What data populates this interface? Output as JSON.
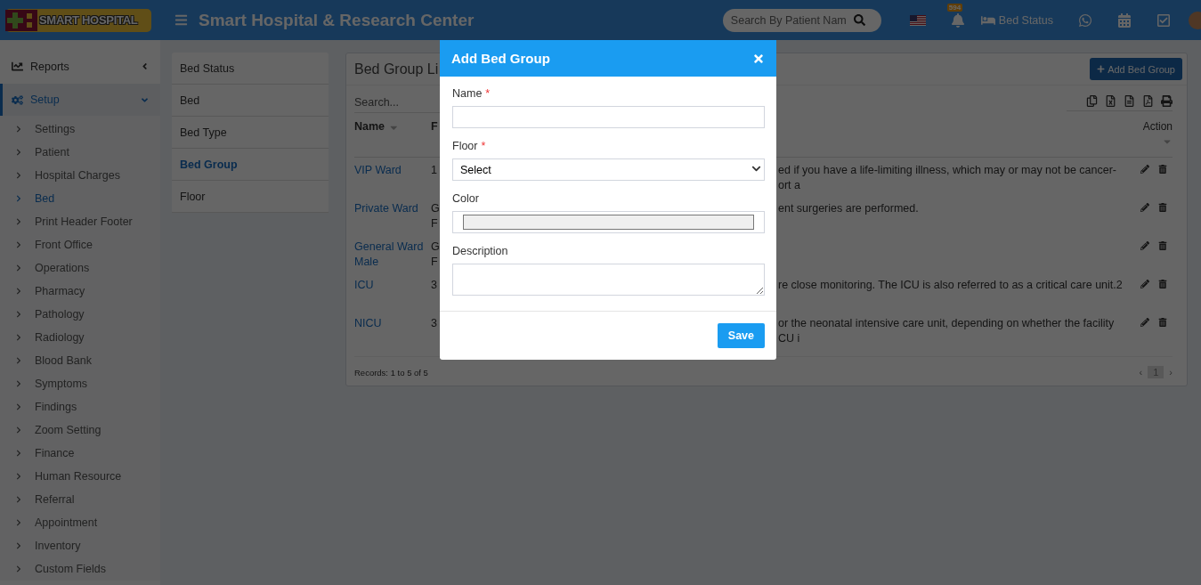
{
  "header": {
    "logo": "SMART HOSPITAL",
    "title": "Smart Hospital & Research Center",
    "search": {
      "placeholder": "Search By Patient Nam"
    },
    "notification_count": "594",
    "bed_status": "Bed Status"
  },
  "sidebar": {
    "sections": [
      {
        "label": "Reports",
        "expanded": false
      },
      {
        "label": "Setup",
        "expanded": true,
        "children": [
          {
            "label": "Settings",
            "selected": false
          },
          {
            "label": "Patient",
            "selected": false
          },
          {
            "label": "Hospital Charges",
            "selected": false
          },
          {
            "label": "Bed",
            "selected": true
          },
          {
            "label": "Print Header Footer",
            "selected": false
          },
          {
            "label": "Front Office",
            "selected": false
          },
          {
            "label": "Operations",
            "selected": false
          },
          {
            "label": "Pharmacy",
            "selected": false
          },
          {
            "label": "Pathology",
            "selected": false
          },
          {
            "label": "Radiology",
            "selected": false
          },
          {
            "label": "Blood Bank",
            "selected": false
          },
          {
            "label": "Symptoms",
            "selected": false
          },
          {
            "label": "Findings",
            "selected": false
          },
          {
            "label": "Zoom Setting",
            "selected": false
          },
          {
            "label": "Finance",
            "selected": false
          },
          {
            "label": "Human Resource",
            "selected": false
          },
          {
            "label": "Referral",
            "selected": false
          },
          {
            "label": "Appointment",
            "selected": false
          },
          {
            "label": "Inventory",
            "selected": false
          },
          {
            "label": "Custom Fields",
            "selected": false
          }
        ]
      }
    ]
  },
  "submenu": {
    "items": [
      {
        "label": "Bed Status",
        "selected": false
      },
      {
        "label": "Bed",
        "selected": false
      },
      {
        "label": "Bed Type",
        "selected": false
      },
      {
        "label": "Bed Group",
        "selected": true
      },
      {
        "label": "Floor",
        "selected": false
      }
    ]
  },
  "card": {
    "title": "Bed Group Li",
    "add_button": "Add Bed Group",
    "search": {
      "placeholder": "Search..."
    },
    "columns": [
      "Name",
      "F",
      "Action"
    ],
    "rows": [
      {
        "name": "VIP Ward",
        "floor": "1",
        "description": "ed if you have a life-limiting illness, which may or may not be cancer-\nort a"
      },
      {
        "name": "Private Ward",
        "floor": "G\nF",
        "description": "ent surgeries are performed."
      },
      {
        "name": "General Ward Male",
        "floor": "G\nF"
      },
      {
        "name": "ICU",
        "floor": "3",
        "description": "re close monitoring. The ICU is also referred to as a critical care unit.2"
      },
      {
        "name": "NICU",
        "floor": "3",
        "description": "or the neonatal intensive care unit, depending on whether the facility\nCU i"
      }
    ],
    "records": "Records: 1 to 5 of 5",
    "pagination": {
      "prev": "‹",
      "next": "›",
      "pages": [
        {
          "label": "1",
          "selected": true
        }
      ]
    }
  },
  "modal": {
    "title": "Add Bed Group",
    "fields": [
      {
        "label": "Name",
        "mark": "*",
        "kind": "text"
      },
      {
        "label": "Floor",
        "mark": "*",
        "kind": "select",
        "value": "Select"
      },
      {
        "label": "Color",
        "kind": "color"
      },
      {
        "label": "Description",
        "kind": "textarea"
      }
    ],
    "save": "Save"
  }
}
